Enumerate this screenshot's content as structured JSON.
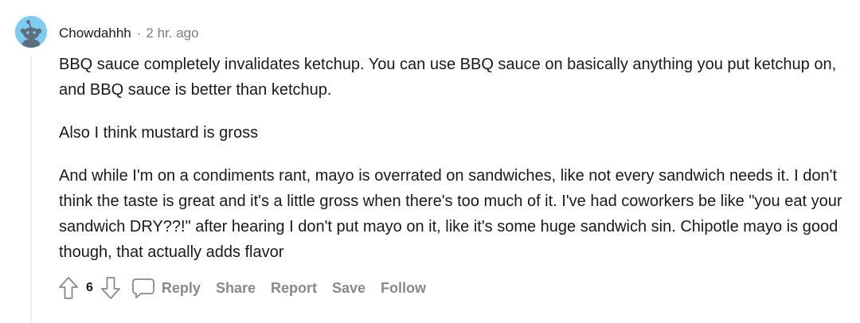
{
  "comment": {
    "author": "Chowdahhh",
    "separator": "·",
    "timestamp": "2 hr. ago",
    "avatar_icon": "snoo-avatar-icon",
    "avatar_color": "#7ecdf1",
    "paragraphs": [
      "BBQ sauce completely invalidates ketchup. You can use BBQ sauce on basically anything you put ketchup on, and BBQ sauce is better than ketchup.",
      "Also I think mustard is gross",
      "And while I'm on a condiments rant, mayo is overrated on sandwiches, like not every sandwich needs it. I don't think the taste is great and it's a little gross when there's too much of it. I've had coworkers be like \"you eat your sandwich DRY??!\" after hearing I don't put mayo on it, like it's some huge sandwich sin. Chipotle mayo is good though, that actually adds flavor"
    ]
  },
  "actions": {
    "upvote_icon": "upvote-arrow-icon",
    "score": "6",
    "downvote_icon": "downvote-arrow-icon",
    "reply_icon": "speech-bubble-icon",
    "reply": "Reply",
    "share": "Share",
    "report": "Report",
    "save": "Save",
    "follow": "Follow"
  }
}
